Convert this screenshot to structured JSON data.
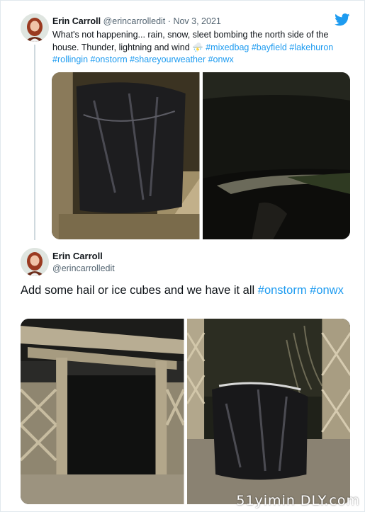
{
  "reply_tweet": {
    "author_name": "Erin Carroll",
    "author_handle": "@erincarrolledit",
    "separator": "·",
    "date": "Nov 3, 2021",
    "text_parts": [
      {
        "type": "text",
        "value": "What's not happening... rain, snow, sleet bombing the north side of the house. Thunder, lightning and wind "
      },
      {
        "type": "text",
        "value": "⛈️"
      },
      {
        "type": "text",
        "value": " "
      },
      {
        "type": "hashtag",
        "value": "#mixedbag"
      },
      {
        "type": "text",
        "value": " "
      },
      {
        "type": "hashtag",
        "value": "#bayfield"
      },
      {
        "type": "text",
        "value": " "
      },
      {
        "type": "hashtag",
        "value": "#lakehuron"
      },
      {
        "type": "text",
        "value": " "
      },
      {
        "type": "hashtag",
        "value": "#rollingin"
      },
      {
        "type": "text",
        "value": " "
      },
      {
        "type": "hashtag",
        "value": "#onstorm"
      },
      {
        "type": "text",
        "value": " "
      },
      {
        "type": "hashtag",
        "value": "#shareyourweather"
      },
      {
        "type": "text",
        "value": " "
      },
      {
        "type": "hashtag",
        "value": "#onwx"
      }
    ],
    "media": [
      "covered-bbq-photo",
      "dark-lake-night-photo"
    ]
  },
  "main_tweet": {
    "author_name": "Erin Carroll",
    "author_handle": "@erincarrolledit",
    "text_parts": [
      {
        "type": "text",
        "value": "Add some hail or ice cubes and we have it all "
      },
      {
        "type": "hashtag",
        "value": "#onstorm"
      },
      {
        "type": "text",
        "value": " "
      },
      {
        "type": "hashtag",
        "value": "#onwx"
      }
    ],
    "media": [
      "pergola-night-photo",
      "covered-bbq-gravel-photo"
    ]
  },
  "icons": {
    "brand": "twitter-bird-icon"
  },
  "colors": {
    "accent": "#1d9bf0",
    "text": "#0f1419",
    "secondary_text": "#536471",
    "thread_line": "#cfd9de"
  },
  "watermark": "51yimin DLY.com"
}
